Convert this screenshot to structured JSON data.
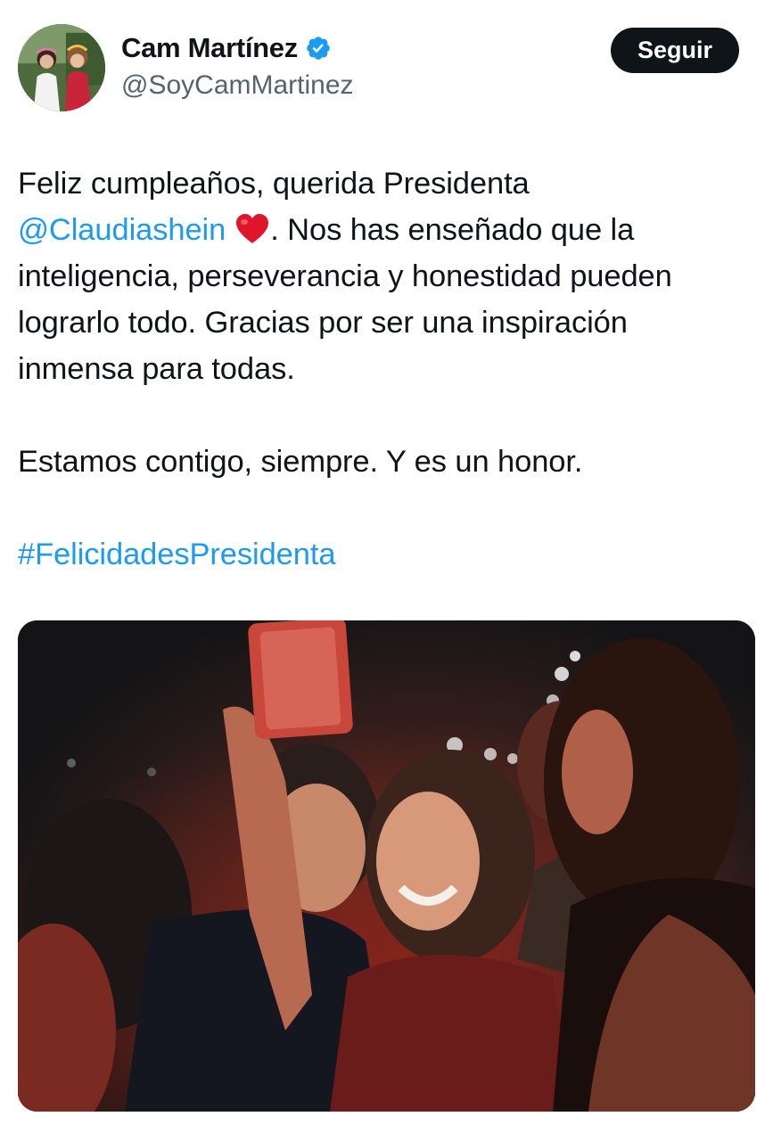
{
  "author": {
    "display_name": "Cam Martínez",
    "handle": "@SoyCamMartinez",
    "verified_icon": "verified-badge-icon",
    "avatar_icon": "avatar-photo"
  },
  "follow_button": {
    "label": "Seguir"
  },
  "tweet": {
    "line1": "Feliz cumpleaños, querida Presidenta",
    "mention": "@Claudiashein",
    "heart_icon": "red-heart-emoji",
    "line2_rest": ". Nos has enseñado que la",
    "line3": "inteligencia, perseverancia y honestidad pueden",
    "line4": "lograrlo todo. Gracias por ser una inspiración",
    "line5": "inmensa para todas.",
    "line6": "Estamos contigo, siempre. Y es un honor.",
    "hashtag": "#FelicidadesPresidenta"
  },
  "media": {
    "type": "photo",
    "icon": "selfie-photo"
  },
  "colors": {
    "link": "#1d9bf0",
    "text": "#0f1419",
    "secondary_text": "#536471",
    "verified": "#1d9bf0",
    "button_bg": "#0f1419"
  }
}
